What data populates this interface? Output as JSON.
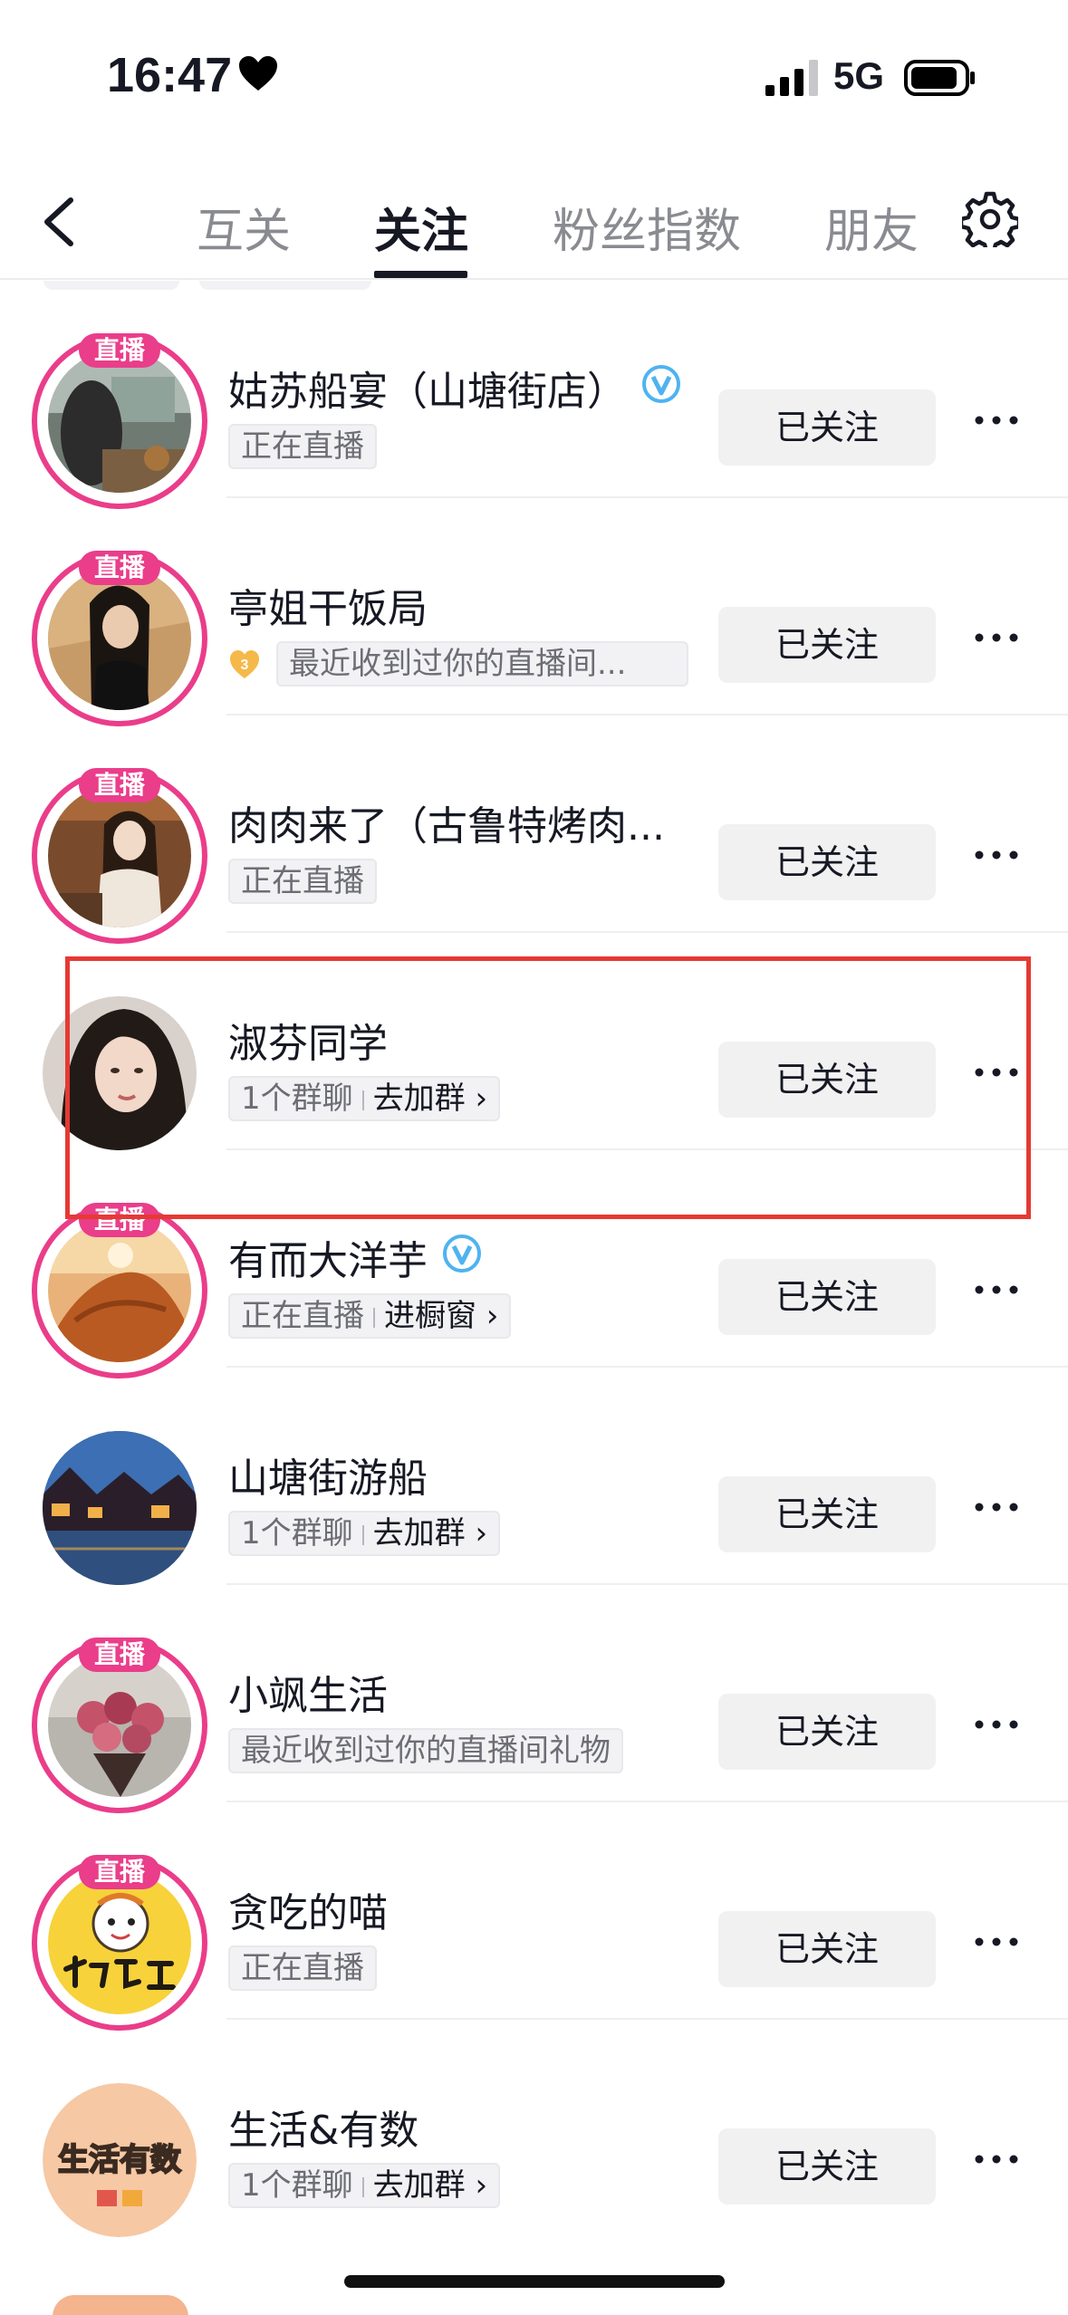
{
  "status_bar": {
    "time": "16:47",
    "network": "5G"
  },
  "nav": {
    "tabs": [
      {
        "label": "互关",
        "active": false
      },
      {
        "label": "关注",
        "active": true
      },
      {
        "label": "粉丝指数",
        "active": false
      },
      {
        "label": "朋友",
        "active": false
      }
    ]
  },
  "live_badge": "直播",
  "follow_label": "已关注",
  "colors": {
    "accent": "#ea3d8a",
    "verified": "#4fb3f0",
    "highlight": "#e53a33"
  },
  "rows": [
    {
      "name": "姑苏船宴（山塘街店）",
      "verified": true,
      "live": true,
      "sub": "正在直播"
    },
    {
      "name": "亭姐干饭局",
      "verified": false,
      "live": true,
      "fan_level": "3",
      "sub": "最近收到过你的直播间..."
    },
    {
      "name": "肉肉来了（古鲁特烤肉...",
      "verified": false,
      "live": true,
      "sub": "正在直播"
    },
    {
      "name": "淑芬同学",
      "verified": false,
      "live": false,
      "sub_a": "1个群聊",
      "sub_b": "去加群 ›"
    },
    {
      "name": "有而大洋芋",
      "verified": true,
      "live": true,
      "sub_a": "正在直播",
      "sub_b": "进橱窗 ›"
    },
    {
      "name": "山塘街游船",
      "verified": false,
      "live": false,
      "sub_a": "1个群聊",
      "sub_b": "去加群 ›"
    },
    {
      "name": "小飒生活",
      "verified": false,
      "live": true,
      "sub": "最近收到过你的直播间礼物"
    },
    {
      "name": "贪吃的喵",
      "verified": false,
      "live": true,
      "sub": "正在直播"
    },
    {
      "name": "生活&有数",
      "verified": false,
      "live": false,
      "sub_a": "1个群聊",
      "sub_b": "去加群 ›",
      "avatar_text": "生活有数"
    }
  ]
}
